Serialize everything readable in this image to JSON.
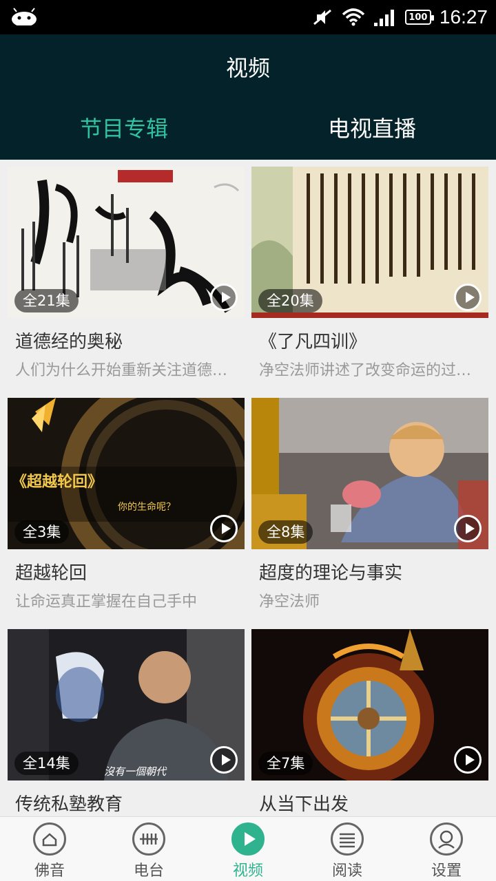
{
  "status_bar": {
    "time": "16:27",
    "battery": "100"
  },
  "header": {
    "title": "视频",
    "tabs": [
      {
        "label": "节目专辑",
        "active": true
      },
      {
        "label": "电视直播",
        "active": false
      }
    ]
  },
  "videos": [
    {
      "title": "道德经的奥秘",
      "episodes": "全21集",
      "desc": "人们为什么开始重新关注道德…"
    },
    {
      "title": "《了凡四训》",
      "episodes": "全20集",
      "desc": "净空法师讲述了改变命运的过…"
    },
    {
      "title": "超越轮回",
      "episodes": "全3集",
      "desc": "让命运真正掌握在自己手中",
      "overlay_title": "《超越轮回》",
      "overlay_sub": "你的生命呢？"
    },
    {
      "title": "超度的理论与事实",
      "episodes": "全8集",
      "desc": "净空法师"
    },
    {
      "title": "传统私塾教育",
      "episodes": "全14集",
      "desc": "",
      "overlay_caption": "沒有一個朝代"
    },
    {
      "title": "从当下出发",
      "episodes": "全7集",
      "desc": ""
    }
  ],
  "bottom_nav": [
    {
      "label": "佛音",
      "icon": "home-icon",
      "active": false
    },
    {
      "label": "电台",
      "icon": "radio-icon",
      "active": false
    },
    {
      "label": "视频",
      "icon": "play-icon",
      "active": true
    },
    {
      "label": "阅读",
      "icon": "read-icon",
      "active": false
    },
    {
      "label": "设置",
      "icon": "user-icon",
      "active": false
    }
  ],
  "colors": {
    "accent": "#2fc3a0",
    "header_bg": "#04222a",
    "status_bg": "#000000"
  }
}
